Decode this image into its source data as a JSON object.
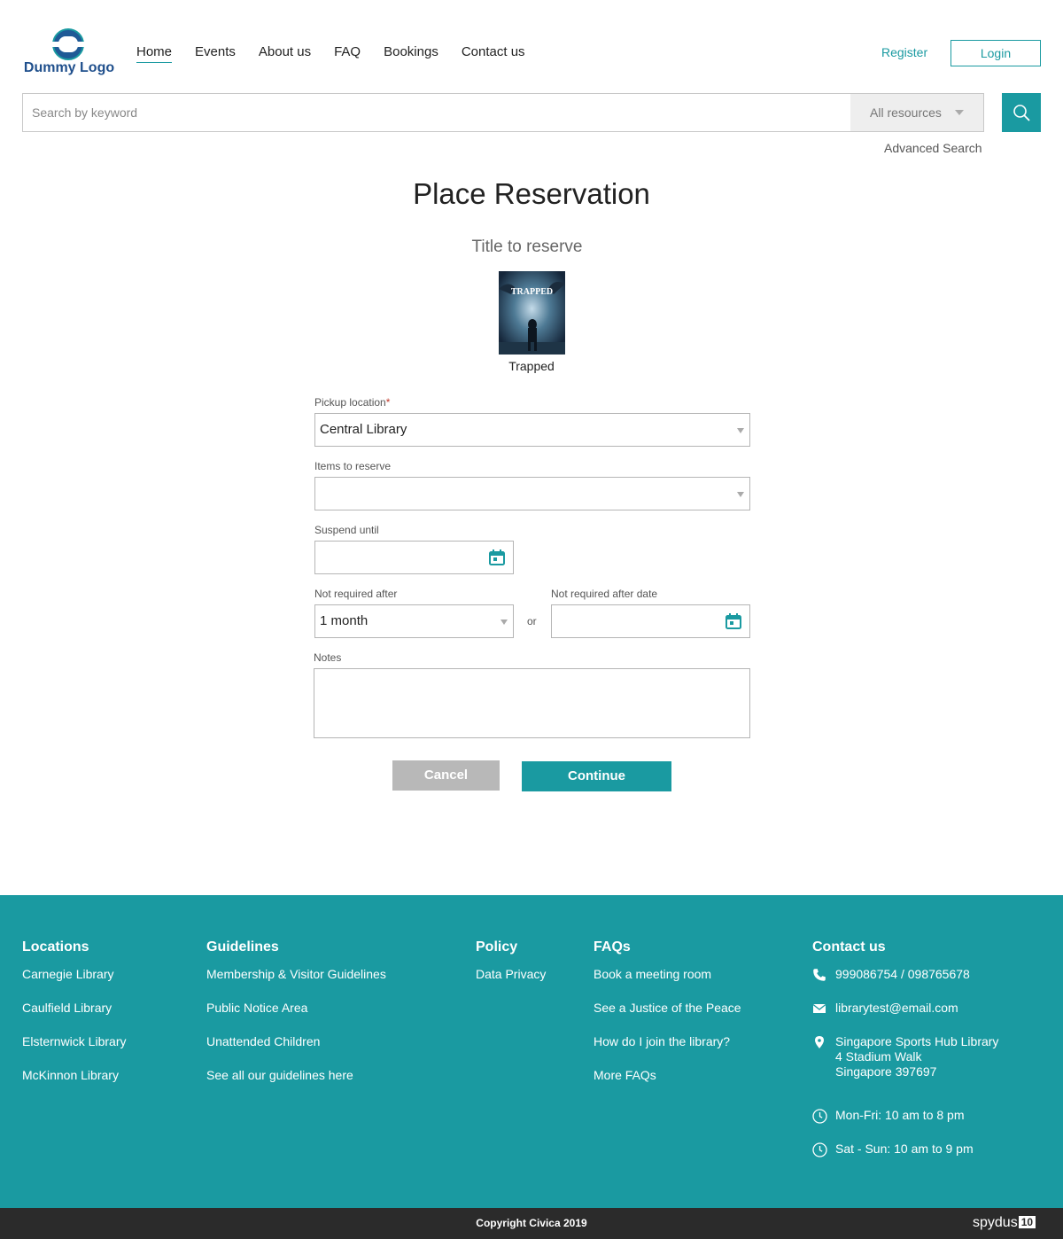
{
  "header": {
    "logo_text": "Dummy Logo",
    "nav": [
      "Home",
      "Events",
      "About us",
      "FAQ",
      "Bookings",
      "Contact us"
    ],
    "active_nav": "Home",
    "register_label": "Register",
    "login_label": "Login"
  },
  "search": {
    "placeholder": "Search by keyword",
    "resource_filter": "All resources",
    "advanced_label": "Advanced Search"
  },
  "main": {
    "title": "Place Reservation",
    "subtitle": "Title to reserve",
    "book": {
      "cover_text": "TRAPPED",
      "title": "Trapped"
    },
    "form": {
      "pickup_label": "Pickup location",
      "pickup_required": "*",
      "pickup_value": "Central Library",
      "items_label": "Items to reserve",
      "items_value": "",
      "suspend_label": "Suspend until",
      "suspend_value": "",
      "not_required_label": "Not required after",
      "not_required_value": "1 month",
      "or_label": "or",
      "not_required_date_label": "Not required after date",
      "not_required_date_value": "",
      "notes_label": "Notes",
      "notes_value": ""
    },
    "cancel_label": "Cancel",
    "continue_label": "Continue"
  },
  "footer": {
    "locations": {
      "heading": "Locations",
      "items": [
        "Carnegie Library",
        "Caulfield Library",
        "Elsternwick Library",
        "McKinnon Library"
      ]
    },
    "guidelines": {
      "heading": "Guidelines",
      "items": [
        "Membership & Visitor Guidelines",
        "Public Notice Area",
        "Unattended Children",
        "See all our guidelines here"
      ]
    },
    "policy": {
      "heading": "Policy",
      "items": [
        "Data Privacy"
      ]
    },
    "faqs": {
      "heading": "FAQs",
      "items": [
        "Book a meeting room",
        "See a Justice of the Peace",
        "How do I join the library?",
        "More FAQs"
      ]
    },
    "contact": {
      "heading": "Contact us",
      "phone": "999086754 / 098765678",
      "email": "librarytest@email.com",
      "address_line1": "Singapore Sports Hub Library",
      "address_line2": "4 Stadium Walk",
      "address_line3": "Singapore 397697",
      "hours_weekday": "Mon-Fri: 10 am to 8 pm",
      "hours_weekend": "Sat - Sun: 10 am to 9 pm"
    },
    "copyright": "Copyright Civica 2019",
    "brand": "spydus",
    "brand_version": "10"
  },
  "colors": {
    "accent": "#1a9aa1",
    "footer_bottom": "#2b2b2b",
    "cancel": "#b8b8b8",
    "logo": "#1f4f8c"
  }
}
